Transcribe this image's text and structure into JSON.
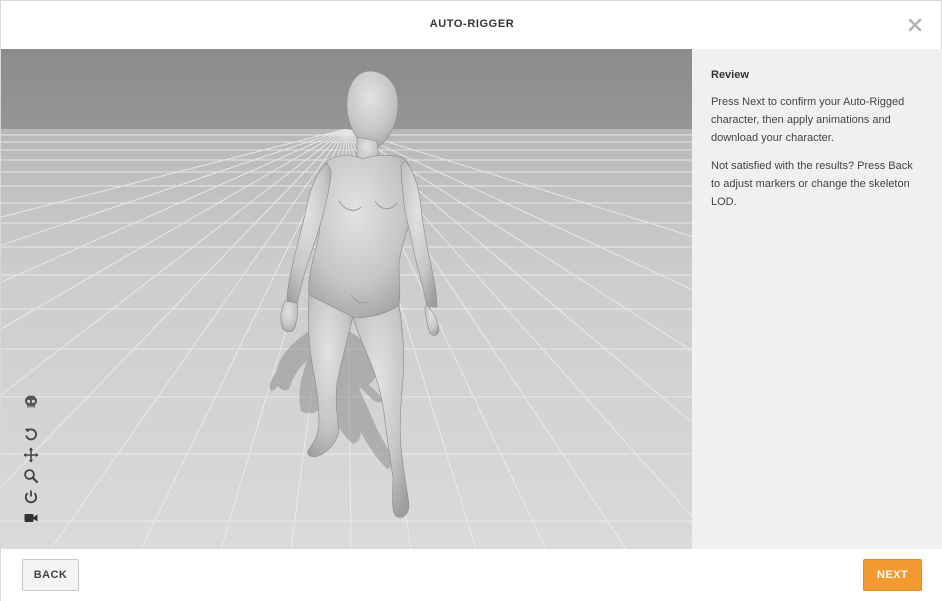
{
  "header": {
    "title": "AUTO-RIGGER"
  },
  "viewport": {
    "tools": [
      "skull-icon",
      "undo-icon",
      "move-icon",
      "search-icon",
      "power-icon",
      "camera-icon"
    ]
  },
  "side": {
    "heading": "Review",
    "paragraph1": "Press Next to confirm your Auto-Rigged character, then apply animations and download your character.",
    "paragraph2": "Not satisfied with the results? Press Back to adjust markers or change the skeleton LOD."
  },
  "footer": {
    "back_label": "BACK",
    "next_label": "NEXT"
  },
  "colors": {
    "accent": "#f39a2f",
    "panel": "#f0f0f0",
    "floor": "#d6d6d6"
  }
}
